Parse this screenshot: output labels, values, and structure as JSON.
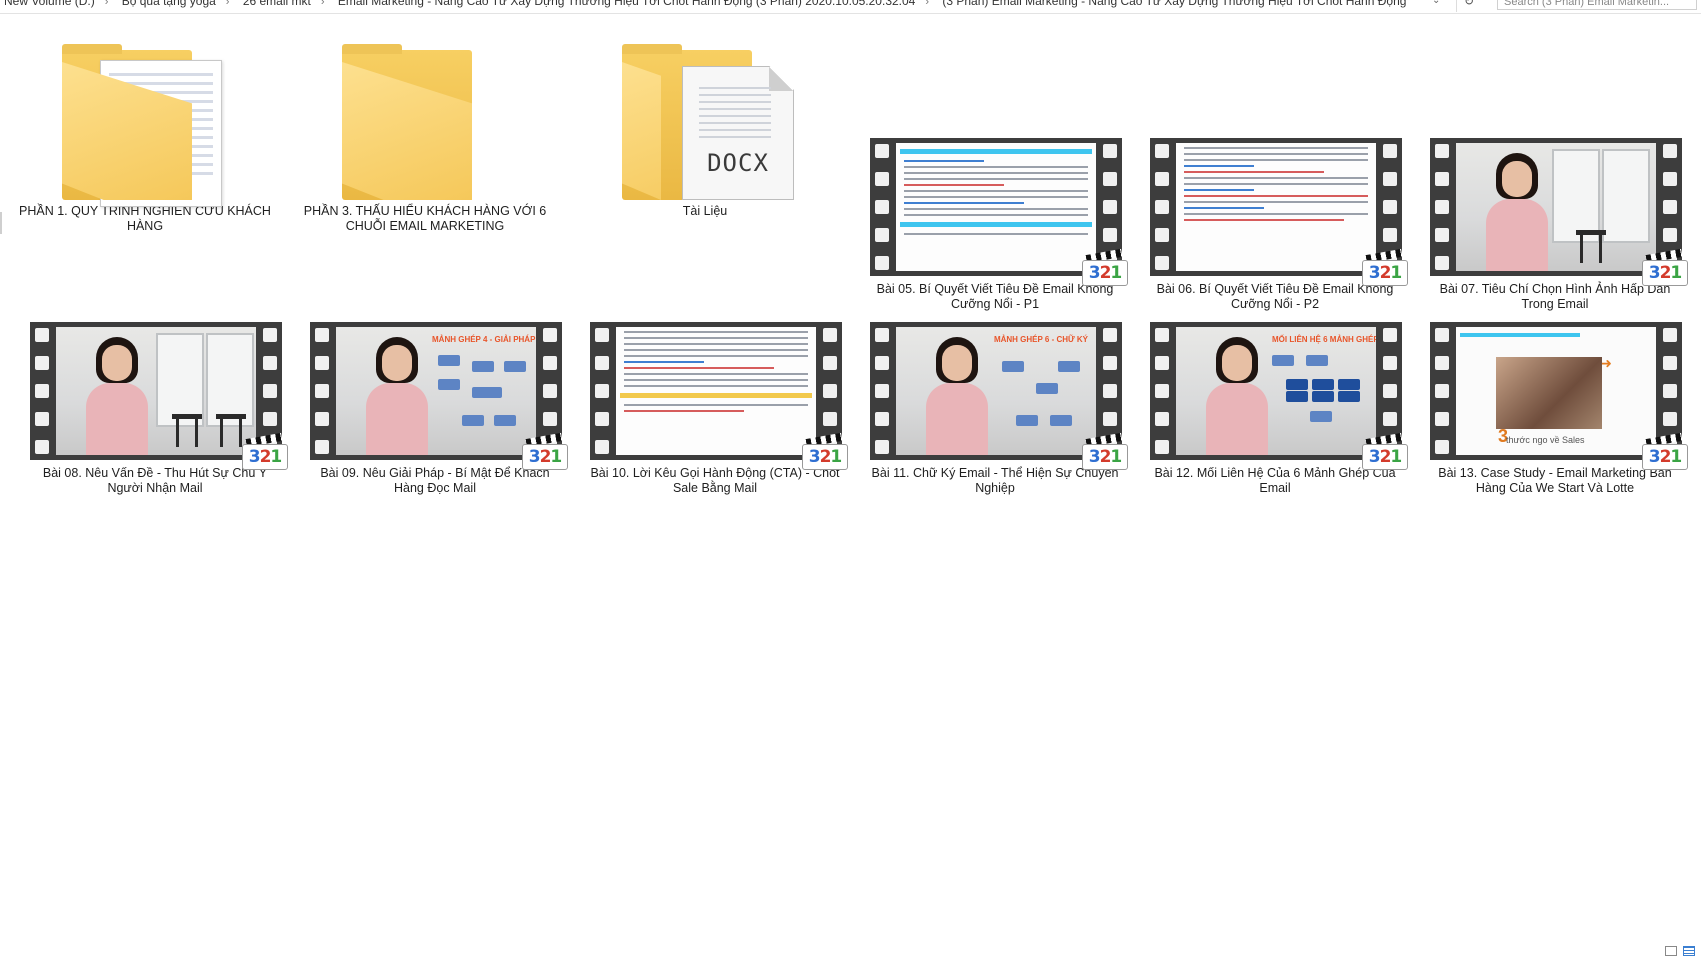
{
  "address_bar": {
    "crumbs": [
      "New Volume (D:)",
      "Bộ quà tặng yoga",
      "26 email mkt",
      "Email Marketing - Nâng Cao Từ Xây Dựng Thương Hiệu Tới Chốt Hành Động (3 Phần) 2020.10.05.20.32.04",
      "(3 Phần) Email Marketing - Nâng Cao Từ Xây Dựng Thương Hiệu Tới Chốt Hành Động"
    ],
    "search_placeholder": "Search (3 Phần) Email Marketin..."
  },
  "files": [
    {
      "label": "PHẦN 1. QUY TRÌNH NGHIÊN CỨU KHÁCH HÀNG",
      "kind": "folder-with-doc"
    },
    {
      "label": "PHẦN 3. THẤU HIỂU KHÁCH HÀNG VỚI 6 CHUỖI EMAIL MARKETING",
      "kind": "folder"
    },
    {
      "label": "Tài Liệu",
      "kind": "folder-docx",
      "docx_text": "DOCX"
    },
    {
      "label": "Bài 05. Bí Quyết Viết Tiêu Đề Email Không Cưỡng Nổi - P1",
      "kind": "video-doc"
    },
    {
      "label": "Bài 06. Bí Quyết Viết Tiêu Đề Email Không Cưỡng Nổi - P2",
      "kind": "video-doc"
    },
    {
      "label": "Bài 07. Tiêu Chí Chọn Hình Ảnh Hấp Dẫn Trong Email",
      "kind": "video-person"
    },
    {
      "label": "Bài 08. Nêu Vấn Đề - Thu Hút Sự Chú Ý Người Nhận Mail",
      "kind": "video-person"
    },
    {
      "label": "Bài 09. Nêu Giải Pháp - Bí Mật Để Khách Hàng Đọc Mail",
      "kind": "video-person",
      "slide_title": "MẢNH GHÉP 4 - GIẢI PHÁP"
    },
    {
      "label": "Bài 10. Lời Kêu Gọi Hành Động (CTA) - Chốt Sale Bằng Mail",
      "kind": "video-doc"
    },
    {
      "label": "Bài 11. Chữ Ký Email - Thể Hiện Sự Chuyên Nghiệp",
      "kind": "video-person",
      "slide_title": "MẢNH GHÉP 6 - CHỮ KÝ"
    },
    {
      "label": "Bài 12. Mối Liên Hệ Của 6 Mảnh Ghép Của Email",
      "kind": "video-person",
      "slide_title": "MỐI LIÊN HỆ 6 MẢNH GHÉP"
    },
    {
      "label": "Bài 13. Case Study - Email Marketing Bán Hàng Của We Start Và Lotte",
      "kind": "video-photo",
      "photo_caption": "thước ngo về Sales"
    }
  ],
  "badge": {
    "d3": "3",
    "d2": "2",
    "d1": "1"
  },
  "icons": {
    "refresh": "refresh-icon",
    "chevron": "chevron-down-icon",
    "details_view": "details-view-icon",
    "large_icons_view": "large-icons-view-icon"
  }
}
